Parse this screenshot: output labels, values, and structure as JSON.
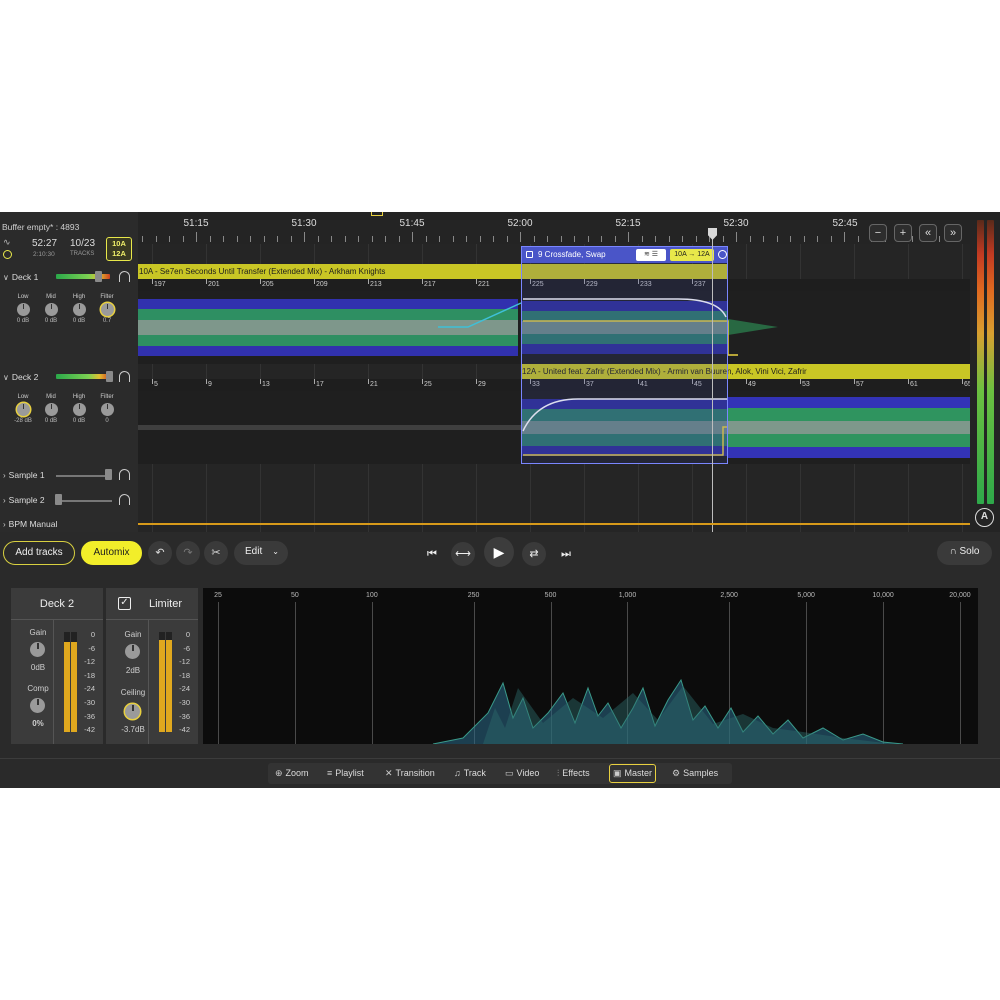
{
  "status": {
    "buffer": "Buffer empty* : 4893",
    "time_main": "52:27",
    "time_sub": "2:10:30",
    "tracks_main": "10/23",
    "tracks_sub": "TRACKS",
    "key_top": "10A",
    "key_bottom": "12A"
  },
  "decks": [
    {
      "label": "Deck 1",
      "eq": [
        {
          "name": "Low",
          "value": "0 dB"
        },
        {
          "name": "Mid",
          "value": "0 dB"
        },
        {
          "name": "High",
          "value": "0 dB"
        },
        {
          "name": "Filter",
          "value": "0.7"
        }
      ]
    },
    {
      "label": "Deck 2",
      "eq": [
        {
          "name": "Low",
          "value": "-28 dB"
        },
        {
          "name": "Mid",
          "value": "0 dB"
        },
        {
          "name": "High",
          "value": "0 dB"
        },
        {
          "name": "Filter",
          "value": "0"
        }
      ]
    }
  ],
  "samples": [
    "Sample 1",
    "Sample 2"
  ],
  "bpm_label": "BPM Manual",
  "ruler_labels": [
    "51:15",
    "51:30",
    "51:45",
    "52:00",
    "52:15",
    "52:30",
    "52:45"
  ],
  "track1": {
    "title": "10A - Se7en Seconds Until Transfer (Extended Mix) - Arkham Knights",
    "beats": [
      "197",
      "201",
      "205",
      "209",
      "213",
      "217",
      "221",
      "225",
      "229",
      "233",
      "237"
    ]
  },
  "track2": {
    "title": "12A - United feat. Zafrir (Extended Mix) - Armin van Buuren, Alok, Vini Vici, Zafrir",
    "beats": [
      "5",
      "9",
      "13",
      "17",
      "21",
      "25",
      "29",
      "33",
      "37",
      "41",
      "45",
      "49",
      "53",
      "57",
      "61",
      "65"
    ]
  },
  "crossfade": {
    "label": "9 Crossfade, Swap",
    "key_change": "10A → 12A"
  },
  "transport": {
    "add_tracks": "Add tracks",
    "automix": "Automix",
    "edit": "Edit",
    "solo": "Solo"
  },
  "deck_panel": {
    "title": "Deck 2",
    "gain_label": "Gain",
    "gain_value": "0dB",
    "comp_label": "Comp",
    "comp_value": "0%",
    "meter_level": 0.9
  },
  "limiter_panel": {
    "title": "Limiter",
    "gain_label": "Gain",
    "gain_value": "2dB",
    "ceiling_label": "Ceiling",
    "ceiling_value": "-3.7dB",
    "meter_level": 0.92
  },
  "db_scale": [
    "0",
    "-6",
    "-12",
    "-18",
    "-24",
    "-30",
    "-36",
    "-42"
  ],
  "freq_labels": [
    "25",
    "50",
    "100",
    "250",
    "500",
    "1,000",
    "2,500",
    "5,000",
    "10,000",
    "20,000"
  ],
  "nav": [
    {
      "label": "Zoom",
      "icon": "zoom-icon"
    },
    {
      "label": "Playlist",
      "icon": "playlist-icon"
    },
    {
      "label": "Transition",
      "icon": "transition-icon"
    },
    {
      "label": "Track",
      "icon": "music-note-icon"
    },
    {
      "label": "Video",
      "icon": "video-icon"
    },
    {
      "label": "Effects",
      "icon": "sliders-icon"
    },
    {
      "label": "Master",
      "icon": "master-icon",
      "active": true
    },
    {
      "label": "Samples",
      "icon": "gear-icon"
    }
  ],
  "colors": {
    "accent": "#f2ee2a",
    "track_bar": "#c9c625",
    "crossfade": "#4a55c8",
    "wave_blue": "#3a3ad0",
    "wave_green": "#30a060",
    "wave_grey": "#9a9a9a"
  }
}
